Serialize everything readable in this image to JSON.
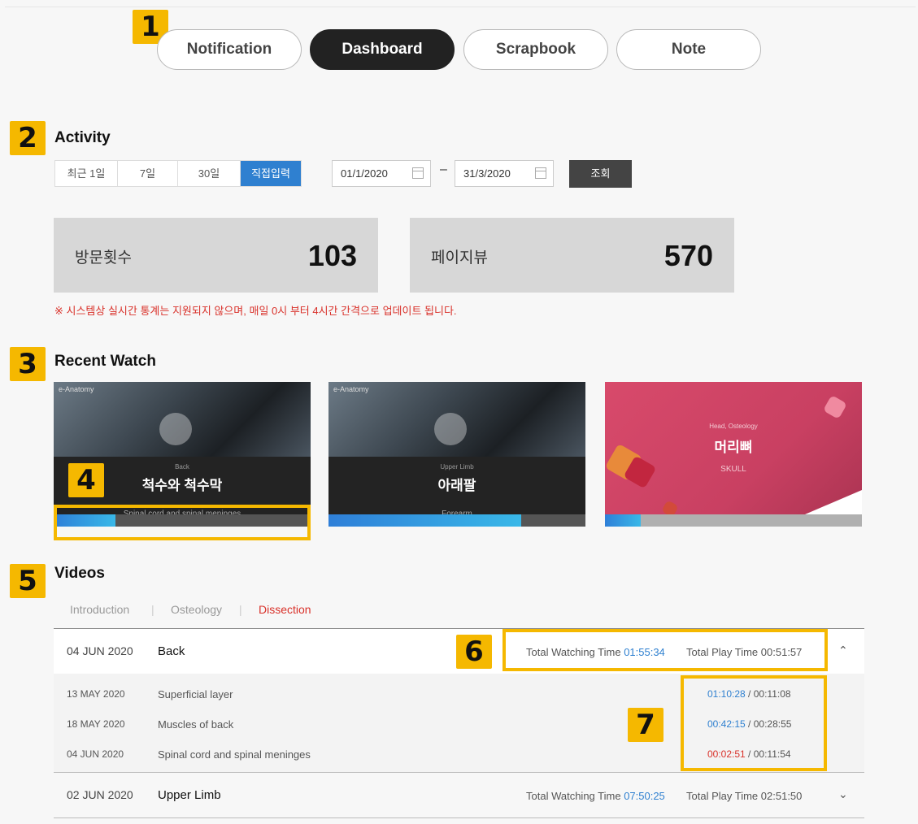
{
  "badges": [
    "1",
    "2",
    "3",
    "4",
    "5",
    "6",
    "7"
  ],
  "tabs": [
    {
      "label": "Notification",
      "active": false
    },
    {
      "label": "Dashboard",
      "active": true
    },
    {
      "label": "Scrapbook",
      "active": false
    },
    {
      "label": "Note",
      "active": false
    }
  ],
  "activity": {
    "title": "Activity",
    "periods": [
      "최근 1일",
      "7일",
      "30일",
      "직접입력"
    ],
    "selected_period": "직접입력",
    "date_from": "01/1/2020",
    "date_to": "31/3/2020",
    "dash": "–",
    "search_label": "조회",
    "visits_label": "방문횟수",
    "visits_value": "103",
    "pageviews_label": "페이지뷰",
    "pageviews_value": "570",
    "notice": "※ 시스템상 실시간 통계는 지원되지 않으며, 매일 0시 부터 4시간 간격으로 업데이트 됩니다."
  },
  "recent_watch": {
    "title": "Recent Watch",
    "items": [
      {
        "brand": "e-Anatomy",
        "small": "Back",
        "title": "척수와 척수막",
        "subtitle": "Spinal cord and spinal meninges",
        "progress": 0.24
      },
      {
        "brand": "e-Anatomy",
        "small": "Upper Limb",
        "title": "아래팔",
        "subtitle": "Forearm",
        "progress": 0.75
      },
      {
        "brand": "",
        "small": "Head, Osteology",
        "title": "머리뼈",
        "subtitle": "SKULL",
        "progress": 0.14
      }
    ]
  },
  "videos": {
    "title": "Videos",
    "subtabs": [
      "Introduction",
      "Osteology",
      "Dissection"
    ],
    "active_subtab": "Dissection",
    "groups": [
      {
        "date": "04 JUN 2020",
        "name": "Back",
        "watching_label": "Total Watching Time",
        "watching": "01:55:34",
        "play_label": "Total Play Time",
        "play": "00:51:57",
        "expanded": true,
        "chevron": "⌃",
        "items": [
          {
            "date": "13 MAY 2020",
            "name": "Superficial layer",
            "watched": "01:10:28",
            "duration": "00:11:08",
            "color": "#2f80d0"
          },
          {
            "date": "18 MAY 2020",
            "name": "Muscles of back",
            "watched": "00:42:15",
            "duration": "00:28:55",
            "color": "#2f80d0"
          },
          {
            "date": "04 JUN 2020",
            "name": "Spinal cord and spinal meninges",
            "watched": "00:02:51",
            "duration": "00:11:54",
            "color": "#d9312a"
          }
        ]
      },
      {
        "date": "02 JUN 2020",
        "name": "Upper Limb",
        "watching_label": "Total Watching Time",
        "watching": "07:50:25",
        "play_label": "Total Play Time",
        "play": "02:51:50",
        "expanded": false,
        "chevron": "⌄"
      }
    ]
  },
  "colors": {
    "accent_blue": "#2f80d0",
    "alert_red": "#d9312a",
    "badge_yellow": "#f5b800"
  }
}
